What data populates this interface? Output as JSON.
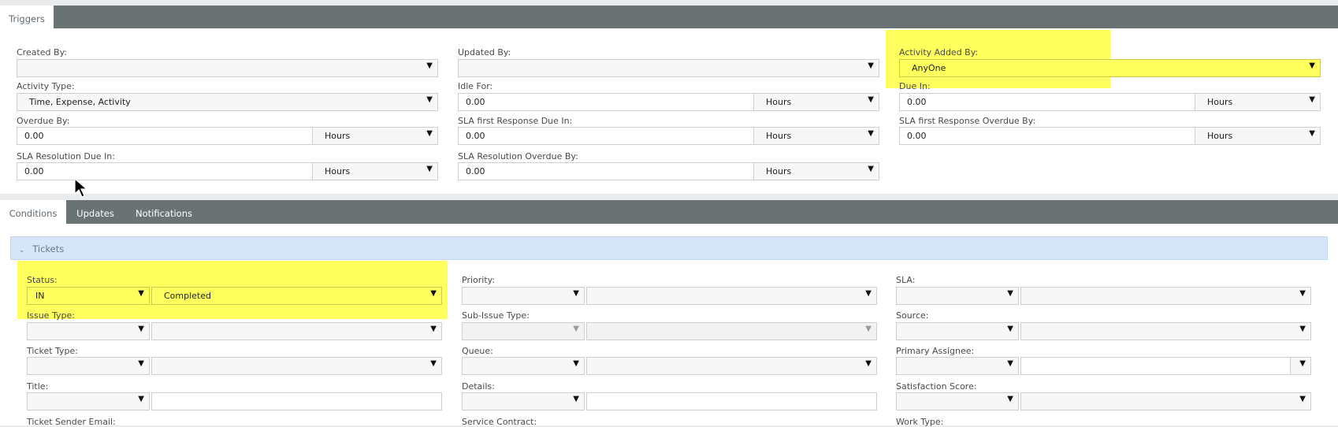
{
  "triggers": {
    "tab_label": "Triggers",
    "fields": {
      "created_by": {
        "label": "Created By:",
        "value": ""
      },
      "updated_by": {
        "label": "Updated By:",
        "value": ""
      },
      "activity_added_by": {
        "label": "Activity Added By:",
        "value": "AnyOne"
      },
      "activity_type": {
        "label": "Activity Type:",
        "value": "Time, Expense, Activity"
      },
      "idle_for": {
        "label": "Idle For:",
        "value": "0.00",
        "unit": "Hours"
      },
      "due_in": {
        "label": "Due In:",
        "value": "0.00",
        "unit": "Hours"
      },
      "overdue_by": {
        "label": "Overdue By:",
        "value": "0.00",
        "unit": "Hours"
      },
      "sla_first_response_due_in": {
        "label": "SLA first Response Due In:",
        "value": "0.00",
        "unit": "Hours"
      },
      "sla_first_response_overdue_by": {
        "label": "SLA first Response Overdue By:",
        "value": "0.00",
        "unit": "Hours"
      },
      "sla_resolution_due_in": {
        "label": "SLA Resolution Due In:",
        "value": "0.00",
        "unit": "Hours"
      },
      "sla_resolution_overdue_by": {
        "label": "SLA Resolution Overdue By:",
        "value": "0.00",
        "unit": "Hours"
      }
    }
  },
  "bottom_tabs": [
    {
      "label": "Conditions",
      "active": true
    },
    {
      "label": "Updates",
      "active": false
    },
    {
      "label": "Notifications",
      "active": false
    }
  ],
  "tickets": {
    "title": "Tickets",
    "fields": {
      "status": {
        "label": "Status:",
        "operator": "IN",
        "value": "Completed"
      },
      "priority": {
        "label": "Priority:",
        "operator": "",
        "value": ""
      },
      "sla": {
        "label": "SLA:",
        "operator": "",
        "value": ""
      },
      "issue_type": {
        "label": "Issue Type:",
        "operator": "",
        "value": ""
      },
      "sub_issue_type": {
        "label": "Sub-Issue Type:",
        "operator": "",
        "value": ""
      },
      "source": {
        "label": "Source:",
        "operator": "",
        "value": ""
      },
      "ticket_type": {
        "label": "Ticket Type:",
        "operator": "",
        "value": ""
      },
      "queue": {
        "label": "Queue:",
        "operator": "",
        "value": ""
      },
      "primary_assignee": {
        "label": "Primary Assignee:",
        "operator": "",
        "value": ""
      },
      "title_field": {
        "label": "Title:",
        "operator": "",
        "value": ""
      },
      "details": {
        "label": "Details:",
        "operator": "",
        "value": ""
      },
      "satisfaction_score": {
        "label": "Satisfaction Score:",
        "operator": "",
        "value": ""
      },
      "ticket_sender_email": {
        "label": "Ticket Sender Email:"
      },
      "service_contract": {
        "label": "Service Contract:"
      },
      "work_type": {
        "label": "Work Type:"
      }
    }
  },
  "colors": {
    "tab_bar": "#6b7274",
    "highlight": "#ffff5e",
    "section_header": "#d6e6f8"
  },
  "icons": {
    "dropdown": "▼",
    "collapse": "chevron-down"
  }
}
